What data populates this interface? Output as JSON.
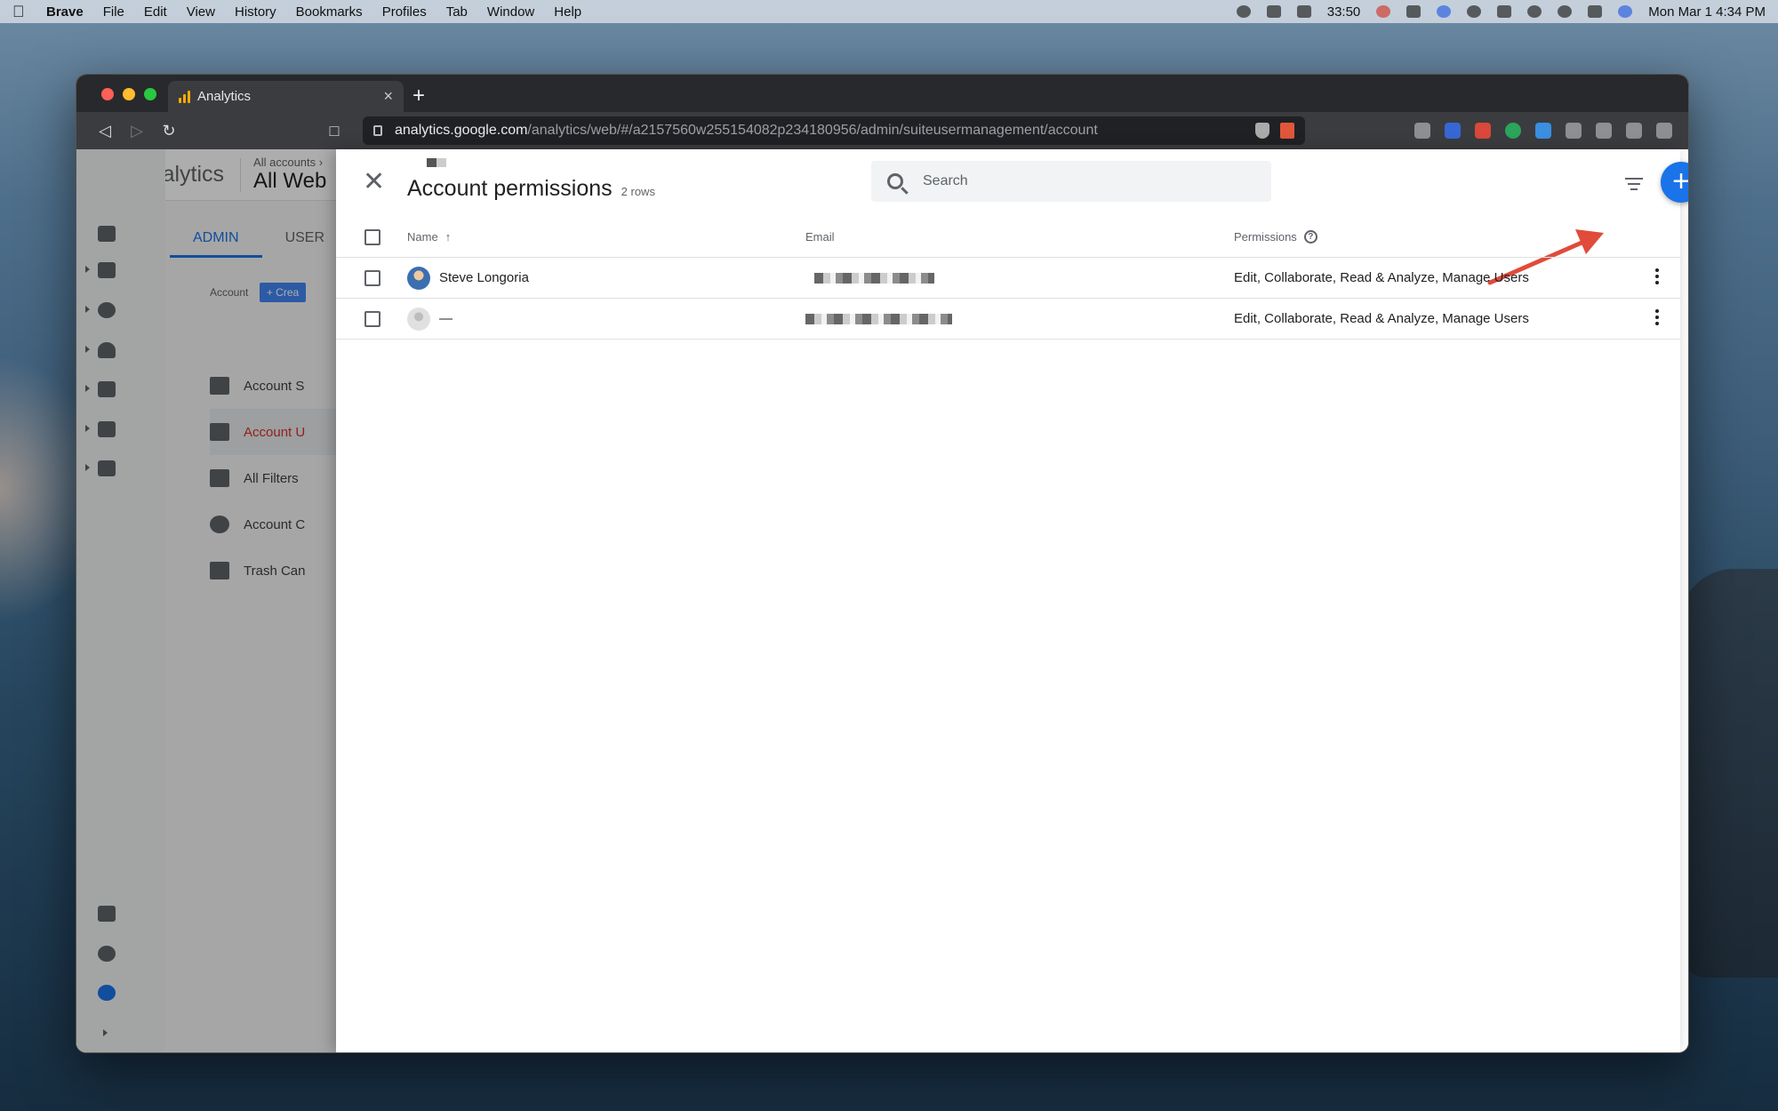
{
  "menubar": {
    "app": "Brave",
    "items": [
      "File",
      "Edit",
      "View",
      "History",
      "Bookmarks",
      "Profiles",
      "Tab",
      "Window",
      "Help"
    ],
    "timer": "33:50",
    "clock": "Mon Mar 1  4:34 PM"
  },
  "browser": {
    "tab_title": "Analytics",
    "new_tab": "+",
    "url_host": "analytics.google.com",
    "url_path": "/analytics/web/#/a2157560w255154082p234180956/admin/suiteusermanagement/account"
  },
  "ga": {
    "product": "Analytics",
    "breadcrumb_small": "All accounts ›",
    "account_name": "All Web",
    "tabs": [
      "ADMIN",
      "USER"
    ],
    "account_label": "Account",
    "create_label": "+ Crea",
    "admin_items": [
      "Account S",
      "Account U",
      "All Filters",
      "Account C",
      "Trash Can"
    ]
  },
  "drawer": {
    "title": "Account permissions",
    "row_count": "2 rows",
    "search_placeholder": "Search",
    "add_label": "+",
    "columns": {
      "name": "Name",
      "email": "Email",
      "permissions": "Permissions"
    },
    "rows": [
      {
        "name": "Steve Longoria",
        "permissions": "Edit, Collaborate, Read & Analyze, Manage Users"
      },
      {
        "name": "—",
        "permissions": "Edit, Collaborate, Read & Analyze, Manage Users"
      }
    ]
  },
  "colors": {
    "accent": "#1a73e8",
    "arrow": "#e04b3a",
    "analytics_orange": "#f9ab00"
  }
}
